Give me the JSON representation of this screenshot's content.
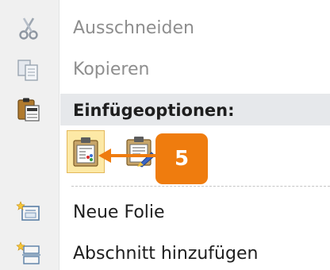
{
  "menu": {
    "cut": {
      "label": "Ausschneiden",
      "icon": "scissors-icon",
      "enabled": false
    },
    "copy": {
      "label": "Kopieren",
      "icon": "copy-icon",
      "enabled": false
    },
    "paste_header": {
      "label": "Einfügeoptionen:",
      "icon": "clipboard-icon"
    },
    "paste_options": [
      {
        "name": "paste-keep-source-formatting",
        "icon": "paste-keep-formatting-icon",
        "selected": true
      },
      {
        "name": "paste-use-destination-theme",
        "icon": "paste-destination-theme-icon",
        "selected": false
      }
    ],
    "new_slide": {
      "label": "Neue Folie",
      "icon": "new-slide-icon",
      "enabled": true
    },
    "add_section": {
      "label": "Abschnitt hinzufügen",
      "icon": "add-section-icon",
      "enabled": true
    }
  },
  "callout": {
    "number": "5",
    "color": "#ef7c0e"
  },
  "colors": {
    "gutter": "#f0f0f0",
    "selected_bg": "#fde9a6",
    "selected_border": "#e3b85b",
    "disabled_text": "#8e8e8e"
  }
}
